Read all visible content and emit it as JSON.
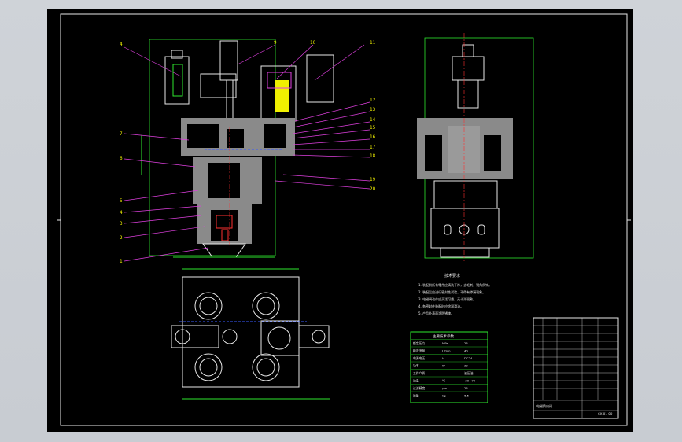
{
  "window": {
    "title": ""
  },
  "colors": {
    "background": "#000000",
    "frame": "#ffffff",
    "green": "#2ee82e",
    "magenta": "#e040e0",
    "yellow": "#f0f000",
    "white": "#e8e8e8",
    "red": "#ff3030",
    "blue": "#3a5bff",
    "cyan": "#33e0e0"
  },
  "callouts": {
    "left": [
      "4",
      "7",
      "6",
      "5",
      "4",
      "3",
      "2",
      "1"
    ],
    "top": [
      "9",
      "10",
      "11"
    ],
    "right": [
      "12",
      "13",
      "14",
      "15",
      "16",
      "17",
      "18",
      "19",
      "20"
    ]
  },
  "tech_notes": {
    "title": "技术要求",
    "lines": [
      "1. 装配前所有零件应清洗干净，去毛刺，锐角倒钝。",
      "2. 装配后应进行密封性试验，不得有渗漏现象。",
      "3. 电磁阀动作应灵活可靠，无卡滞现象。",
      "4. 各密封件装配时应涂润滑油。",
      "5. 产品外表面涂防锈漆。"
    ]
  },
  "param_table": {
    "title": "主要技术参数",
    "rows": [
      [
        "额定压力",
        "MPa",
        "25"
      ],
      [
        "额定流量",
        "L/min",
        "40"
      ],
      [
        "电源电压",
        "V",
        "DC24"
      ],
      [
        "功率",
        "W",
        "30"
      ],
      [
        "工作介质",
        "",
        "液压油"
      ],
      [
        "油温",
        "℃",
        "-20~70"
      ],
      [
        "过滤精度",
        "μm",
        "25"
      ],
      [
        "质量",
        "kg",
        "6.5"
      ]
    ]
  },
  "title_block": {
    "drawing_no": "CX-01-00",
    "name": "电磁换向阀"
  }
}
